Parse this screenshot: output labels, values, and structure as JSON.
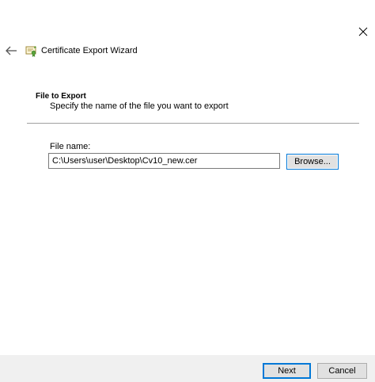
{
  "window": {
    "title": "Certificate Export Wizard",
    "title_icon": "certificate-icon",
    "close_icon": "close-icon",
    "back_icon": "back-arrow-icon"
  },
  "section": {
    "title": "File to Export",
    "description": "Specify the name of the file you want to export"
  },
  "form": {
    "file_name_label": "File name:",
    "file_name_value": "C:\\Users\\user\\Desktop\\Cv10_new.cer",
    "browse_label": "Browse..."
  },
  "footer": {
    "next_label": "Next",
    "cancel_label": "Cancel"
  }
}
